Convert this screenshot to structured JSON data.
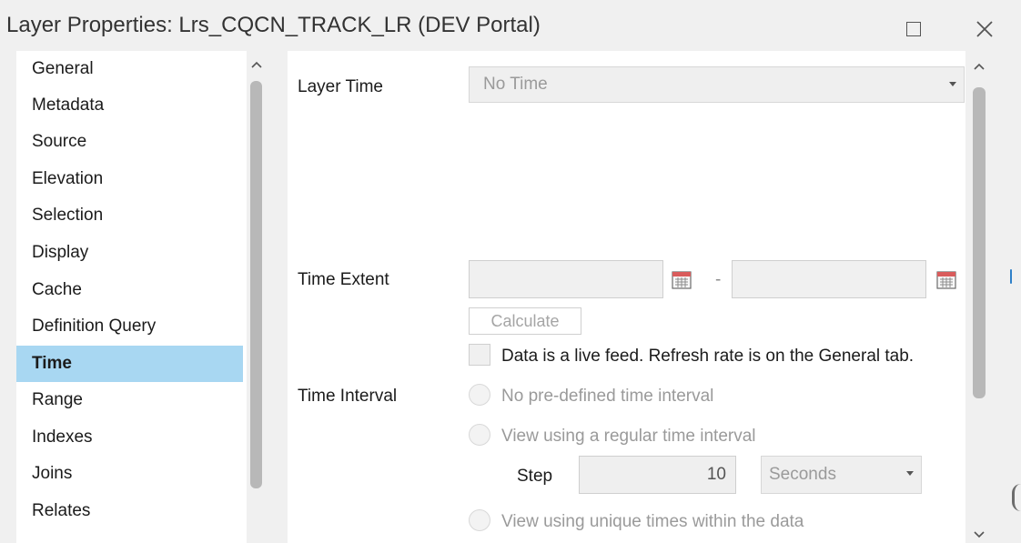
{
  "window": {
    "title": "Layer Properties: Lrs_CQCN_TRACK_LR (DEV Portal)",
    "maximize_icon": "maximize-icon",
    "close_icon": "close-icon"
  },
  "sidebar": {
    "items": [
      {
        "label": "General",
        "selected": false
      },
      {
        "label": "Metadata",
        "selected": false
      },
      {
        "label": "Source",
        "selected": false
      },
      {
        "label": "Elevation",
        "selected": false
      },
      {
        "label": "Selection",
        "selected": false
      },
      {
        "label": "Display",
        "selected": false
      },
      {
        "label": "Cache",
        "selected": false
      },
      {
        "label": "Definition Query",
        "selected": false
      },
      {
        "label": "Time",
        "selected": true
      },
      {
        "label": "Range",
        "selected": false
      },
      {
        "label": "Indexes",
        "selected": false
      },
      {
        "label": "Joins",
        "selected": false
      },
      {
        "label": "Relates",
        "selected": false
      }
    ],
    "selected_color": "#a8d7f2"
  },
  "time_panel": {
    "layer_time": {
      "label": "Layer Time",
      "value": "No Time"
    },
    "time_extent": {
      "label": "Time Extent",
      "start_value": "",
      "separator": "-",
      "end_value": "",
      "calculate_label": "Calculate",
      "live_feed_label": "Data is a live feed. Refresh rate is on the General tab."
    },
    "time_interval": {
      "label": "Time Interval",
      "options": [
        "No pre-defined time interval",
        "View using a regular time interval",
        "View using unique times within the data"
      ],
      "step_label": "Step",
      "step_value": "10",
      "unit_value": "Seconds"
    }
  }
}
